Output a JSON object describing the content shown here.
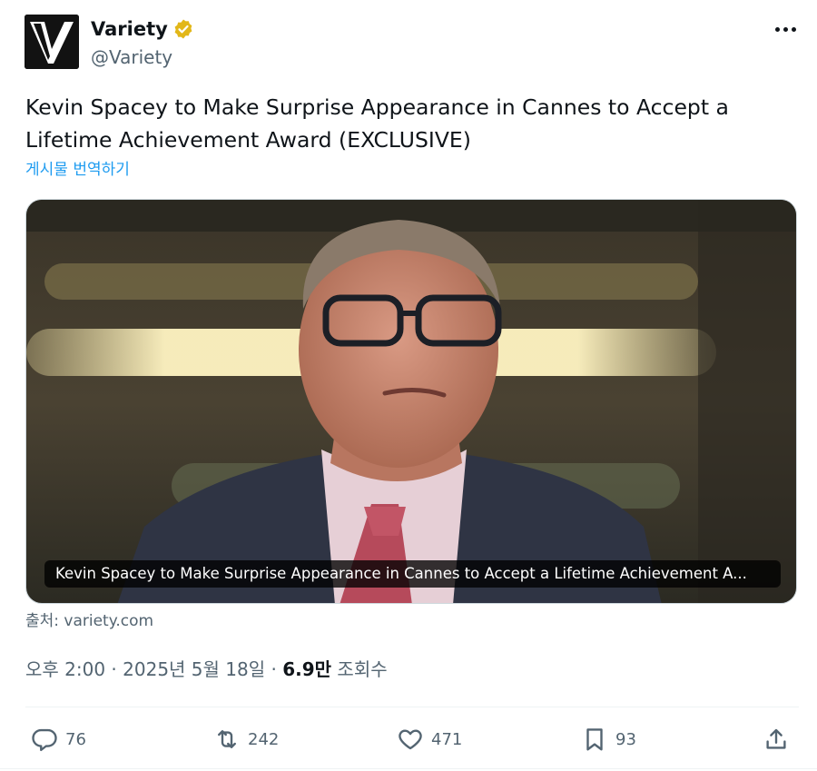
{
  "account": {
    "display_name": "Variety",
    "handle": "@Variety",
    "avatar_icon": "variety-v-logo",
    "verified_color": "#e2b719"
  },
  "post": {
    "text": "Kevin Spacey to Make Surprise Appearance in Cannes to Accept a Lifetime Achievement Award (EXCLUSIVE)",
    "translate_label": "게시물 번역하기"
  },
  "media": {
    "caption": "Kevin Spacey to Make Surprise Appearance in Cannes to Accept a Lifetime Achievement A...",
    "source_label": "출처: variety.com"
  },
  "meta": {
    "time": "오후 2:00",
    "separator": " · ",
    "date": "2025년 5월 18일",
    "views_count": "6.9만",
    "views_label": " 조회수"
  },
  "actions": {
    "reply_count": "76",
    "repost_count": "242",
    "like_count": "471",
    "bookmark_count": "93"
  },
  "colors": {
    "link": "#1d9bf0",
    "secondary_text": "#536471",
    "primary_text": "#0f1419"
  }
}
